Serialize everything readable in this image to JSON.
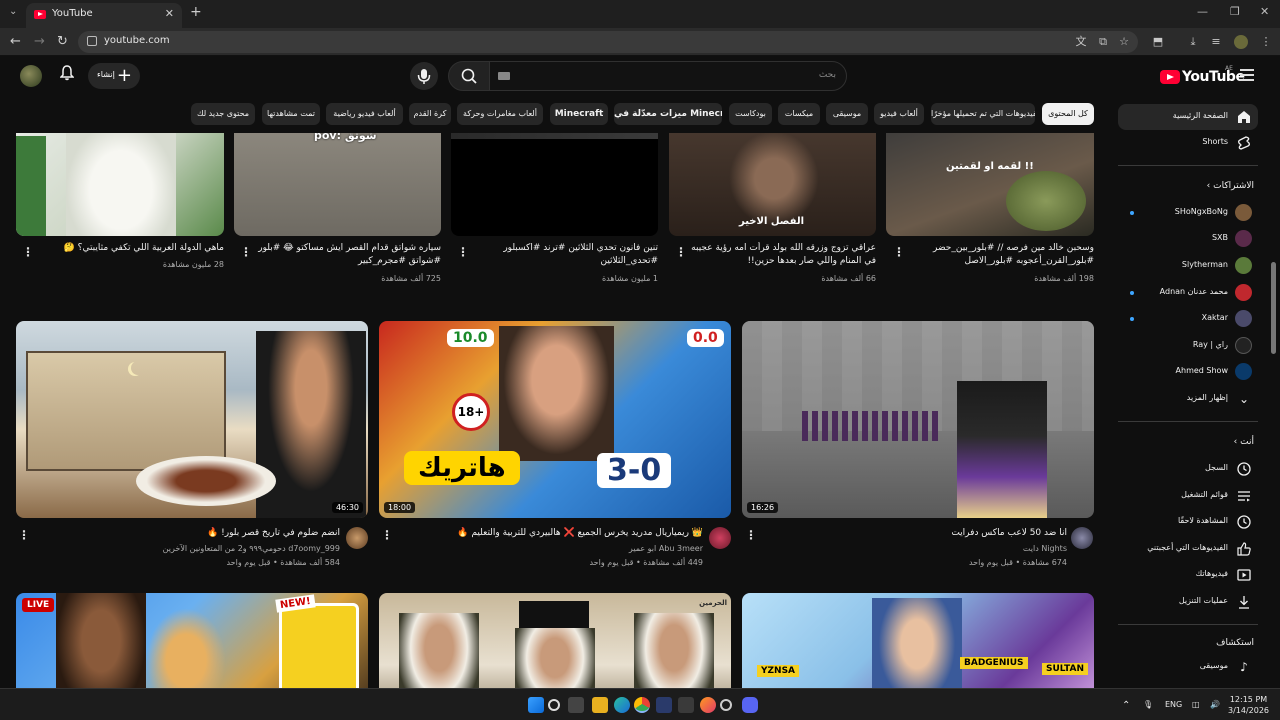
{
  "browser": {
    "tab_title": "YouTube",
    "tab_close": "✕",
    "new_tab": "+",
    "url": "youtube.com"
  },
  "header": {
    "create_label": "إنشاء",
    "search_placeholder": "بحث",
    "logo_text": "YouTube",
    "region": "AE"
  },
  "chips": [
    "كل المحتوى",
    "الفيديوهات التي تم تحميلها مؤخرًا",
    "ألعاب فيديو",
    "موسيقى",
    "ميكسات",
    "بودكاست",
    "ميزات معدّلة في Minecraft",
    "Minecraft",
    "ألعاب مغامرات وحركة",
    "كرة القدم",
    "ألعاب فيديو رياضية",
    "تمت مشاهدتها",
    "محتوى جديد لك"
  ],
  "row1": [
    {
      "title": "ماهي الدولة العربية اللي تكفي مثايبتي؟ 🤔",
      "views": "28 مليون مشاهدة",
      "overlay": ""
    },
    {
      "title": "سياره شواتق قدام القصر ايش مساكتو 😂 #بلور #شواتق #مجرم_كبير",
      "views": "725 ألف مشاهدة",
      "overlay": "pov: شوتق"
    },
    {
      "title": "تنين فانون تحدي الثلاثين #ترند #اكسبلور #تحدي_الثلاثين",
      "views": "1 مليون مشاهدة",
      "overlay": ""
    },
    {
      "title": "عراقي تزوج وزرقه الله بولد قرأت امه رؤية عجيبه في المنام واللي صار بعدها حزين!! #motivation",
      "views": "66 ألف مشاهدة",
      "overlay": "الفصل الاخير"
    },
    {
      "title": "وسحبن خالد مين فرصه // #بلور_بين_حضر #بلور_القرن_أعجوبه #بلور_الاصل #شواتق_بلوق...",
      "views": "198 ألف مشاهدة",
      "overlay": "لقمه او لقمتين !!"
    }
  ],
  "row2": [
    {
      "title": "انا ضد 50 لاعب ماكس دفرايت",
      "channel": "Nights دايت",
      "meta": "674 مشاهدة • قبل يوم واحد",
      "duration": "16:26"
    },
    {
      "title": "👑 ريميأريال مدريد يخرس الجميع ❌ هالبيردي للتربية والتعليم 🔥",
      "channel": "Abu 3meer ابو عمير",
      "meta": "449 ألف مشاهدة • قبل يوم واحد",
      "duration": "18:00"
    },
    {
      "title": "انضم ضلوم في تاريخ قصر بلور! 🔥",
      "channel": "d7oomy_999 دحومي٩٩٩ و2 من المتعاونين الآخرين",
      "meta": "584 ألف مشاهدة • قبل يوم واحد",
      "duration": "46:30"
    }
  ],
  "thumb_text": {
    "score_left": "10.0",
    "score_right": "0.0",
    "age": "18+",
    "hattrick": "هاتريك",
    "scoreline": "3-0",
    "live": "LIVE",
    "new": "NEW!",
    "haramain": "الحرمين",
    "yznsa": "YZNSA",
    "badgenius": "BADGENIUS",
    "sultan": "SULTAN"
  },
  "sidebar": {
    "home": "الصفحة الرئيسية",
    "shorts": "Shorts",
    "subscriptions": "الاشتراكات",
    "subs": [
      {
        "name": "SHoNgxBoNg",
        "color": "#7a5a3a",
        "dot": true
      },
      {
        "name": "SXB",
        "color": "#5a2a4a",
        "dot": false
      },
      {
        "name": "Slytherman",
        "color": "#5a7a3a",
        "dot": false
      },
      {
        "name": "محمد عدنان Adnan",
        "color": "#c0282e",
        "dot": true
      },
      {
        "name": "Xaktar",
        "color": "#4a4a6a",
        "dot": true
      },
      {
        "name": "راي | Ray",
        "color": "#222222",
        "dot": false
      },
      {
        "name": "Ahmed Show",
        "color": "#0a3a6a",
        "dot": false
      }
    ],
    "show_more": "إظهار المزيد",
    "you": "أنت",
    "you_items": [
      "السجل",
      "قوائم التشغيل",
      "المشاهدة لاحقًا",
      "الفيديوهات التي أعجبتني",
      "فيديوهاتك",
      "عمليات التنزيل"
    ],
    "explore": "استكشاف",
    "explore_items": [
      "موسيقى"
    ]
  },
  "taskbar": {
    "lang": "ENG",
    "time": "12:15 PM",
    "date": "3/14/2026"
  },
  "colors": {
    "accent": "#ff0033",
    "background": "#0f0f0f",
    "chip": "#272727"
  }
}
